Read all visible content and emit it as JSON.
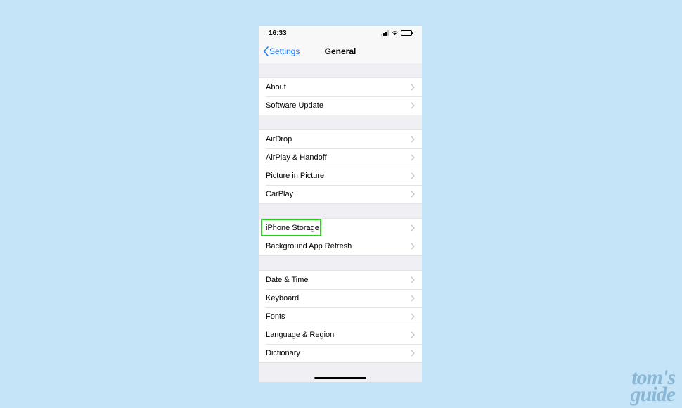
{
  "status": {
    "time": "16:33"
  },
  "nav": {
    "back": "Settings",
    "title": "General"
  },
  "sections": [
    {
      "rows": [
        "About",
        "Software Update"
      ]
    },
    {
      "rows": [
        "AirDrop",
        "AirPlay & Handoff",
        "Picture in Picture",
        "CarPlay"
      ]
    },
    {
      "rows": [
        "iPhone Storage",
        "Background App Refresh"
      ],
      "highlight_index": 0
    },
    {
      "rows": [
        "Date & Time",
        "Keyboard",
        "Fonts",
        "Language & Region",
        "Dictionary"
      ]
    }
  ],
  "watermark": {
    "line1": "tom's",
    "line2": "guide"
  }
}
